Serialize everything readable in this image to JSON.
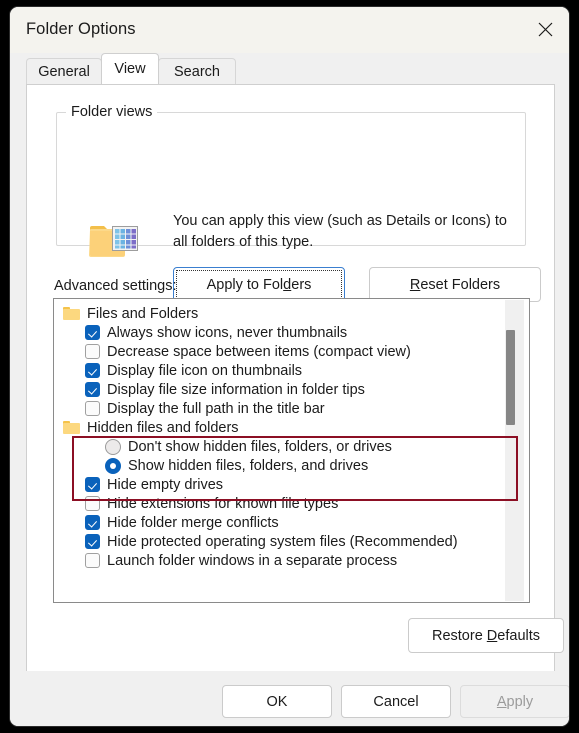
{
  "window": {
    "title": "Folder Options",
    "close_icon": "close-icon"
  },
  "tabs": [
    {
      "label": "General",
      "active": false
    },
    {
      "label": "View",
      "active": true
    },
    {
      "label": "Search",
      "active": false
    }
  ],
  "folder_views": {
    "legend": "Folder views",
    "icon": "folder-details-view-icon",
    "description": "You can apply this view (such as Details or Icons) to all folders of this type.",
    "apply_button": {
      "pre": "Apply to Fol",
      "accel": "d",
      "post": "ers",
      "focused": true
    },
    "reset_button": {
      "pre": "",
      "accel": "R",
      "post": "eset Folders"
    }
  },
  "advanced": {
    "label": "Advanced settings:",
    "rows": [
      {
        "kind": "group",
        "label": "Files and Folders",
        "state": ""
      },
      {
        "kind": "checkbox",
        "label": "Always show icons, never thumbnails",
        "state": "checked"
      },
      {
        "kind": "checkbox",
        "label": "Decrease space between items (compact view)",
        "state": "unchecked"
      },
      {
        "kind": "checkbox",
        "label": "Display file icon on thumbnails",
        "state": "checked"
      },
      {
        "kind": "checkbox",
        "label": "Display file size information in folder tips",
        "state": "checked"
      },
      {
        "kind": "checkbox",
        "label": "Display the full path in the title bar",
        "state": "unchecked"
      },
      {
        "kind": "group",
        "label": "Hidden files and folders",
        "state": ""
      },
      {
        "kind": "radio",
        "label": "Don't show hidden files, folders, or drives",
        "state": "unselected"
      },
      {
        "kind": "radio",
        "label": "Show hidden files, folders, and drives",
        "state": "selected"
      },
      {
        "kind": "checkbox",
        "label": "Hide empty drives",
        "state": "checked"
      },
      {
        "kind": "checkbox",
        "label": "Hide extensions for known file types",
        "state": "unchecked"
      },
      {
        "kind": "checkbox",
        "label": "Hide folder merge conflicts",
        "state": "checked"
      },
      {
        "kind": "checkbox",
        "label": "Hide protected operating system files (Recommended)",
        "state": "checked"
      },
      {
        "kind": "checkbox",
        "label": "Launch folder windows in a separate process",
        "state": "unchecked"
      }
    ],
    "highlight_color": "#8c0f24",
    "scrollbar": {
      "thumb_color": "#868686",
      "track_color": "#f0f0f0"
    }
  },
  "restore_defaults": {
    "pre": "Restore ",
    "accel": "D",
    "post": "efaults"
  },
  "footer": {
    "ok": "OK",
    "cancel": "Cancel",
    "apply": {
      "accel": "A",
      "post": "pply",
      "disabled": true
    }
  },
  "colors": {
    "accent": "#0a62bb",
    "focus_border": "#3a7fd0",
    "highlight": "#8c0f24",
    "disabled_text": "#9b9b9b"
  }
}
